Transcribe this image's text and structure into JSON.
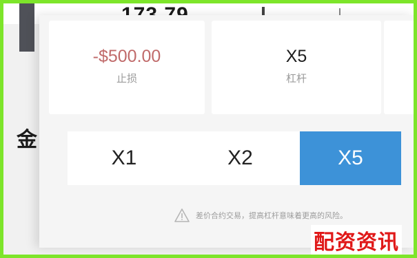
{
  "header": {
    "price_partial": "173.79"
  },
  "sidebar": {
    "char": "金"
  },
  "cards": [
    {
      "value": "-$500.00",
      "label": "止损"
    },
    {
      "value": "X5",
      "label": "杠杆"
    }
  ],
  "leverage": {
    "options": [
      "X1",
      "X2",
      "X5"
    ],
    "selected": "X5"
  },
  "warning": {
    "text": "差价合约交易，提高杠杆意味着更高的风险。"
  },
  "watermark": {
    "text": "配资资讯"
  },
  "colors": {
    "accent": "#3d92d8",
    "negative": "#c06a6a",
    "frame": "#7de52a",
    "watermark": "#e01818"
  }
}
